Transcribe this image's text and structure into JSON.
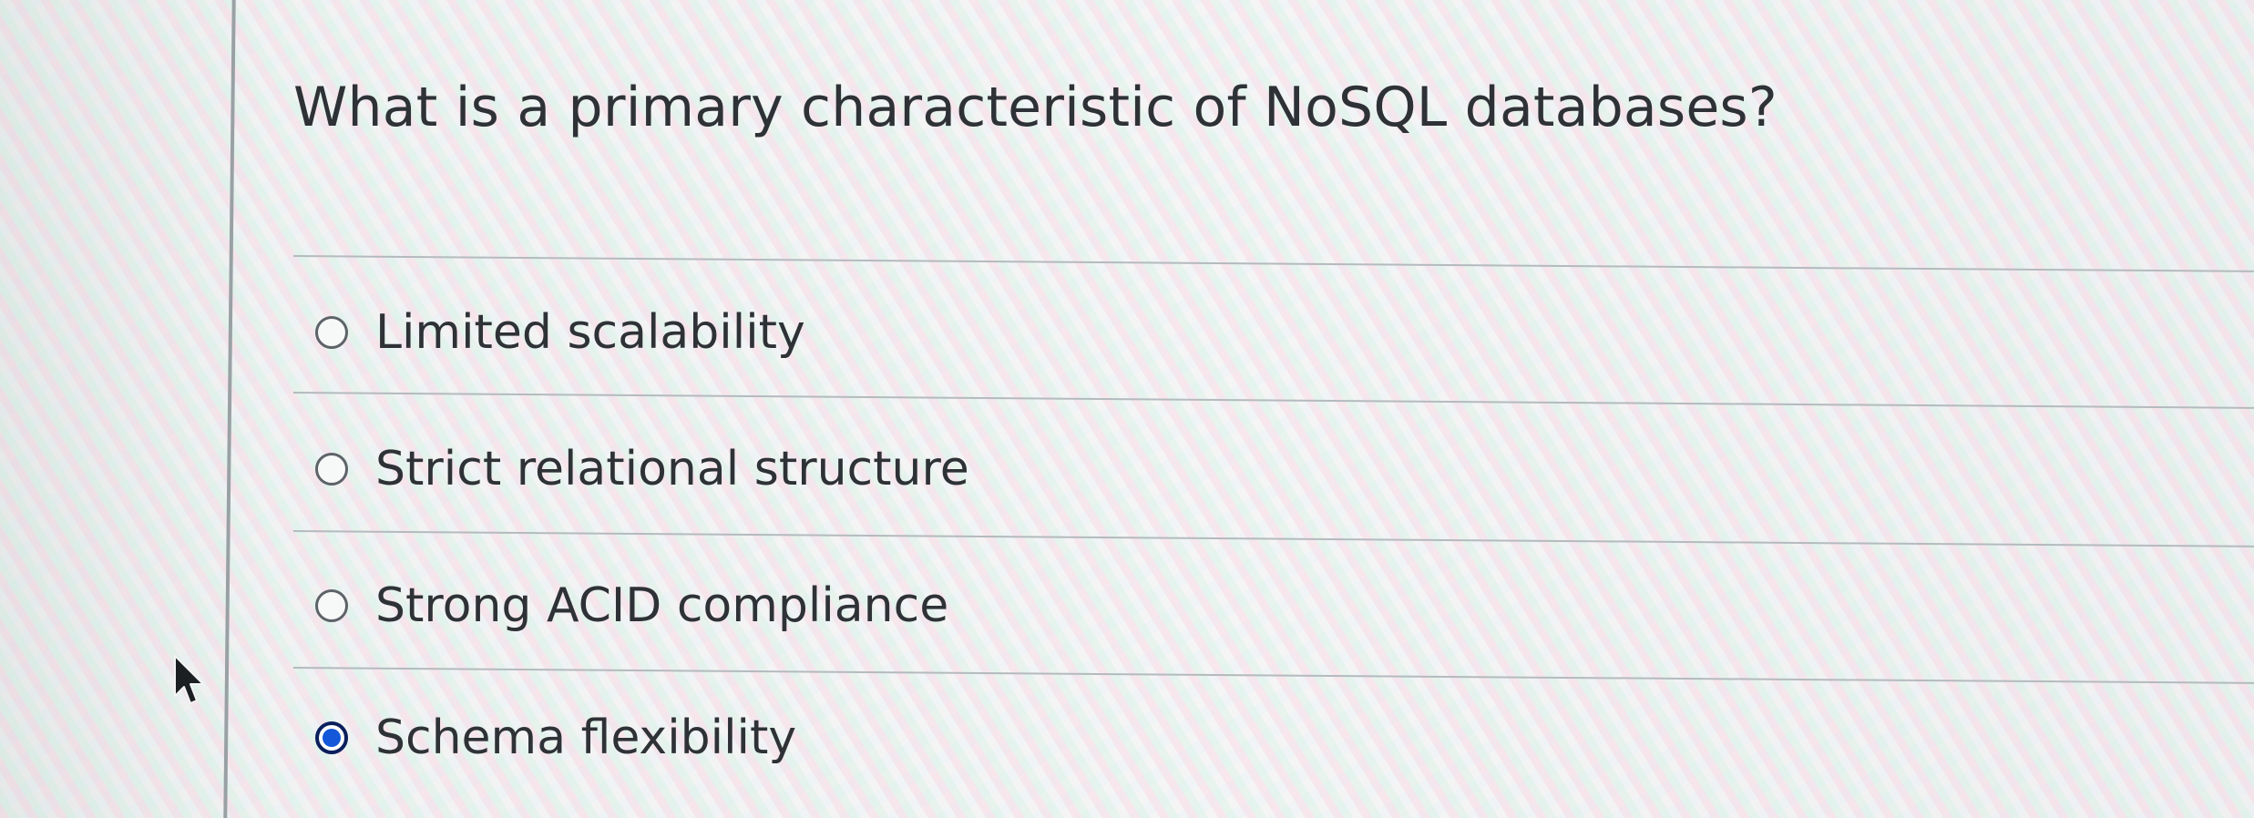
{
  "question": {
    "text": "What is a primary characteristic of NoSQL databases?"
  },
  "options": [
    {
      "label": "Limited scalability",
      "selected": false
    },
    {
      "label": "Strict relational structure",
      "selected": false
    },
    {
      "label": "Strong ACID compliance",
      "selected": false
    },
    {
      "label": "Schema flexibility",
      "selected": true
    }
  ],
  "colors": {
    "selected_radio": "#1457d9",
    "selected_ring": "#0b1f5c",
    "text": "#2e3236",
    "divider": "#b4babd"
  },
  "icons": {
    "cursor": "mouse-pointer-icon"
  }
}
